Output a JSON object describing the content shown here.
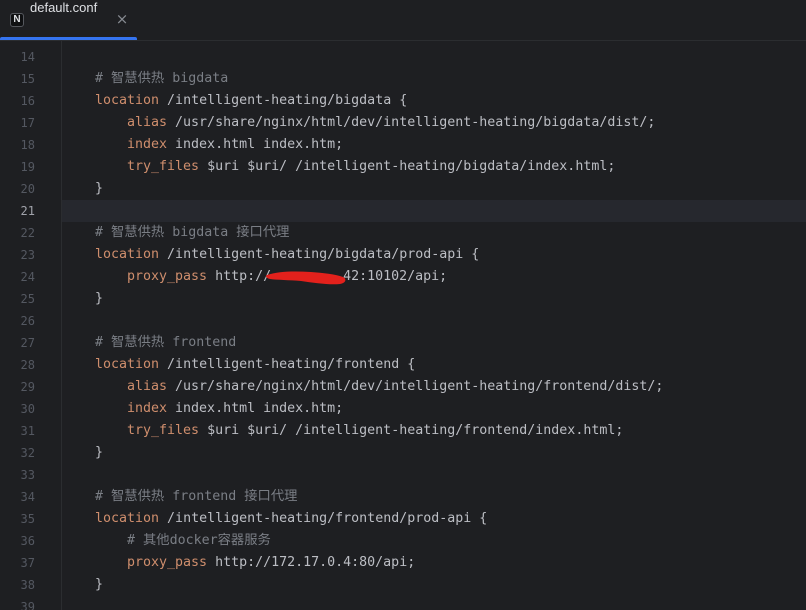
{
  "tab": {
    "filename": "default.conf",
    "file_icon": "nginx-file-icon",
    "file_icon_letter": "N",
    "close_glyph": "×"
  },
  "editor": {
    "current_line": 21,
    "lines": [
      {
        "num": "14"
      },
      {
        "num": "15",
        "comment": "# 智慧供热 bigdata"
      },
      {
        "num": "16",
        "keyword": "location",
        "text": " /intelligent-heating/bigdata {"
      },
      {
        "num": "17",
        "keyword": "alias",
        "text": " /usr/share/nginx/html/dev/intelligent-heating/bigdata/dist/;"
      },
      {
        "num": "18",
        "keyword": "index",
        "text": " index.html index.htm;"
      },
      {
        "num": "19",
        "keyword": "try_files",
        "text": " $uri $uri/ /intelligent-heating/bigdata/index.html;"
      },
      {
        "num": "20",
        "text": "}"
      },
      {
        "num": "21"
      },
      {
        "num": "22",
        "comment": "# 智慧供热 bigdata 接口代理"
      },
      {
        "num": "23",
        "keyword": "location",
        "text": " /intelligent-heating/bigdata/prod-api {"
      },
      {
        "num": "24",
        "keyword": "proxy_pass",
        "text": " http://",
        "after_redaction": "42:10102/api;"
      },
      {
        "num": "25",
        "text": "}"
      },
      {
        "num": "26"
      },
      {
        "num": "27",
        "comment": "# 智慧供热 frontend"
      },
      {
        "num": "28",
        "keyword": "location",
        "text": " /intelligent-heating/frontend {"
      },
      {
        "num": "29",
        "keyword": "alias",
        "text": " /usr/share/nginx/html/dev/intelligent-heating/frontend/dist/;"
      },
      {
        "num": "30",
        "keyword": "index",
        "text": " index.html index.htm;"
      },
      {
        "num": "31",
        "keyword": "try_files",
        "text": " $uri $uri/ /intelligent-heating/frontend/index.html;"
      },
      {
        "num": "32",
        "text": "}"
      },
      {
        "num": "33"
      },
      {
        "num": "34",
        "comment": "# 智慧供热 frontend 接口代理"
      },
      {
        "num": "35",
        "keyword": "location",
        "text": " /intelligent-heating/frontend/prod-api {"
      },
      {
        "num": "36",
        "comment": "# 其他docker容器服务"
      },
      {
        "num": "37",
        "keyword": "proxy_pass",
        "text": " http://172.17.0.4:80/api;"
      },
      {
        "num": "38",
        "text": "}"
      },
      {
        "num": "39"
      }
    ]
  },
  "colors": {
    "background": "#1e1f22",
    "accent": "#3574f0",
    "keyword": "#cf8e6d",
    "comment": "#7a7e85",
    "text": "#bcbec4",
    "redaction": "#e3211c"
  }
}
